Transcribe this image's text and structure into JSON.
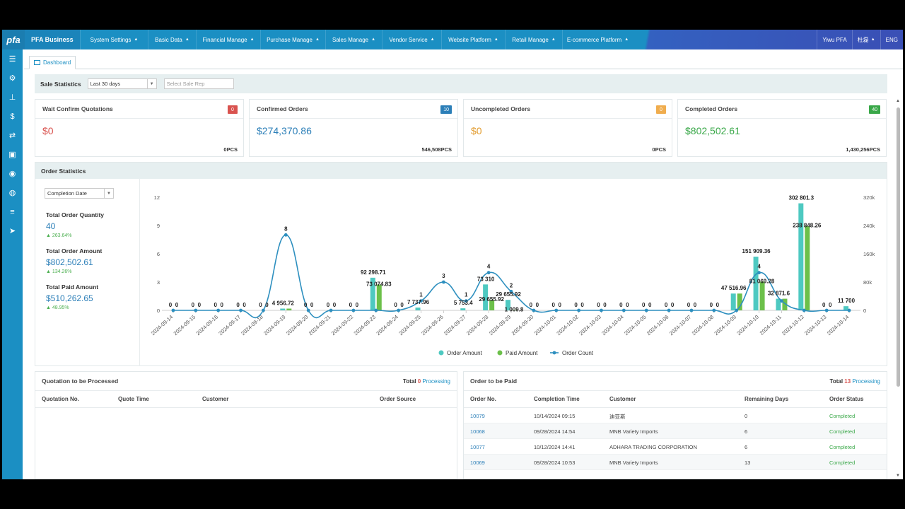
{
  "brand": {
    "logo": "pfa",
    "name": "PFA Business"
  },
  "nav": [
    "System Settings",
    "Basic Data",
    "Financial Manage",
    "Purchase Manage",
    "Sales Manage",
    "Vendor Service",
    "Website Platform",
    "Retail Manage",
    "E-commerce Platform"
  ],
  "topright": {
    "company": "Yiwu PFA",
    "user": "杜磊",
    "lang": "ENG"
  },
  "sidebar_icons": [
    "menu-icon",
    "gear-icon",
    "org-chart-icon",
    "dollar-icon",
    "refresh-icon",
    "cash-icon",
    "user-circle-icon",
    "globe-icon",
    "list-icon",
    "send-icon"
  ],
  "tab": {
    "label": "Dashboard"
  },
  "sale_stats": {
    "label": "Sale Statistics",
    "period": "Last 30 days",
    "sale_rep_placeholder": "Select Sale Rep"
  },
  "cards": [
    {
      "title": "Wait Confirm Quotations",
      "badge": "0",
      "badge_color": "#d9534f",
      "amount": "$0",
      "amount_color": "#d9534f",
      "pcs": "0PCS"
    },
    {
      "title": "Confirmed Orders",
      "badge": "10",
      "badge_color": "#2c7fb8",
      "amount": "$274,370.86",
      "amount_color": "#2c7fb8",
      "pcs": "546,508PCS"
    },
    {
      "title": "Uncompleted Orders",
      "badge": "0",
      "badge_color": "#f0ad4e",
      "amount": "$0",
      "amount_color": "#e29b2d",
      "pcs": "0PCS"
    },
    {
      "title": "Completed Orders",
      "badge": "40",
      "badge_color": "#3aa849",
      "amount": "$802,502.61",
      "amount_color": "#3aa849",
      "pcs": "1,430,256PCS"
    }
  ],
  "order_stats": {
    "title": "Order Statistics",
    "date_type": "Completion Date",
    "total_qty_label": "Total Order Quantity",
    "total_qty": "40",
    "total_qty_pct": "263.64%",
    "total_amount_label": "Total Order Amount",
    "total_amount": "$802,502.61",
    "total_amount_pct": "134.26%",
    "total_paid_label": "Total Paid Amount",
    "total_paid": "$510,262.65",
    "total_paid_pct": "48.95%"
  },
  "chart_data": {
    "type": "bar",
    "categories": [
      "2024-09-14",
      "2024-09-15",
      "2024-09-16",
      "2024-09-17",
      "2024-09-18",
      "2024-09-19",
      "2024-09-20",
      "2024-09-21",
      "2024-09-22",
      "2024-09-23",
      "2024-09-24",
      "2024-09-25",
      "2024-09-26",
      "2024-09-27",
      "2024-09-28",
      "2024-09-29",
      "2024-09-30",
      "2024-10-01",
      "2024-10-02",
      "2024-10-03",
      "2024-10-04",
      "2024-10-05",
      "2024-10-06",
      "2024-10-07",
      "2024-10-08",
      "2024-10-09",
      "2024-10-10",
      "2024-10-11",
      "2024-10-12",
      "2024-10-13",
      "2024-10-14"
    ],
    "series": [
      {
        "name": "Order Amount",
        "axis": "right",
        "color": "#4ec9c1",
        "values": [
          0,
          0,
          0,
          0,
          0,
          4956.72,
          0,
          0,
          0,
          92298.71,
          0,
          7737.96,
          0,
          5753.4,
          73310,
          29655.92,
          0,
          0,
          0,
          0,
          0,
          0,
          0,
          0,
          0,
          47516.96,
          151909.36,
          32871.6,
          302801.3,
          0,
          11700
        ],
        "labels": [
          "0",
          "0",
          "0",
          "0",
          "0",
          "4 956.72",
          "0",
          "0",
          "0",
          "92 298.71",
          "0",
          "7 737.96",
          "",
          "5 753.4",
          "73 310",
          "29 655.92",
          "0",
          "0",
          "0",
          "0",
          "0",
          "0",
          "0",
          "0",
          "0",
          "47 516.96",
          "151 909.36",
          "32 871.6",
          "302 801.3",
          "0",
          "11 700"
        ]
      },
      {
        "name": "Paid Amount",
        "axis": "right",
        "color": "#6cc04a",
        "values": [
          0,
          0,
          0,
          0,
          0,
          4956.72,
          0,
          0,
          0,
          73074.83,
          0,
          0,
          0,
          0,
          29655.92,
          1009.8,
          0,
          0,
          0,
          0,
          0,
          0,
          0,
          0,
          0,
          47516.96,
          81069.28,
          32871.6,
          238848.26,
          0,
          0
        ],
        "labels": [
          "0",
          "0",
          "0",
          "0",
          "0",
          "",
          "0",
          "0",
          "0",
          "73 074.83",
          "0",
          "",
          "",
          "",
          "29 655.92",
          "1 009.8",
          "0",
          "0",
          "0",
          "0",
          "0",
          "0",
          "0",
          "0",
          "0",
          "",
          "81 069.28",
          "",
          "238 848.26",
          "0",
          ""
        ]
      },
      {
        "name": "Order Count",
        "axis": "left",
        "color": "#2d8fbf",
        "values": [
          0,
          0,
          0,
          0,
          0,
          8,
          0,
          0,
          0,
          0,
          0,
          1,
          3,
          1,
          4,
          2,
          0,
          0,
          0,
          0,
          0,
          0,
          0,
          0,
          0,
          0,
          4,
          1,
          0,
          0,
          0
        ],
        "labels": [
          "",
          "",
          "",
          "",
          "",
          "8",
          "",
          "",
          "",
          "",
          "",
          "1",
          "3",
          "1",
          "4",
          "2",
          "",
          "",
          "",
          "",
          "",
          "",
          "",
          "",
          "",
          "",
          "4",
          "",
          "",
          "",
          ""
        ]
      }
    ],
    "left_axis": {
      "ticks": [
        "0",
        "3",
        "6",
        "9",
        "12"
      ],
      "range": [
        0,
        12
      ]
    },
    "right_axis": {
      "ticks": [
        "0",
        "80k",
        "160k",
        "240k",
        "320k"
      ],
      "range": [
        0,
        320000
      ]
    },
    "legend": [
      "Order Amount",
      "Paid Amount",
      "Order Count"
    ]
  },
  "quotation": {
    "title": "Quotation to be Processed",
    "total_label": "Total",
    "total": "0",
    "processing": "Processing",
    "columns": [
      "Quotation No.",
      "Quote Time",
      "Customer",
      "Order Source"
    ]
  },
  "order_paid": {
    "title": "Order to be Paid",
    "total_label": "Total",
    "total": "13",
    "processing": "Processing",
    "columns": [
      "Order No.",
      "Completion Time",
      "Customer",
      "Remaining Days",
      "Order Status"
    ],
    "rows": [
      {
        "no": "10079",
        "time": "10/14/2024 09:15",
        "customer": "迪亚斯",
        "days": "0",
        "status": "Completed"
      },
      {
        "no": "10068",
        "time": "09/28/2024 14:54",
        "customer": "MNB Variety Imports",
        "days": "6",
        "status": "Completed"
      },
      {
        "no": "10077",
        "time": "10/12/2024 14:41",
        "customer": "ADHARA TRADING CORPORATION",
        "days": "6",
        "status": "Completed"
      },
      {
        "no": "10069",
        "time": "09/28/2024 10:53",
        "customer": "MNB Variety Imports",
        "days": "13",
        "status": "Completed"
      }
    ]
  }
}
